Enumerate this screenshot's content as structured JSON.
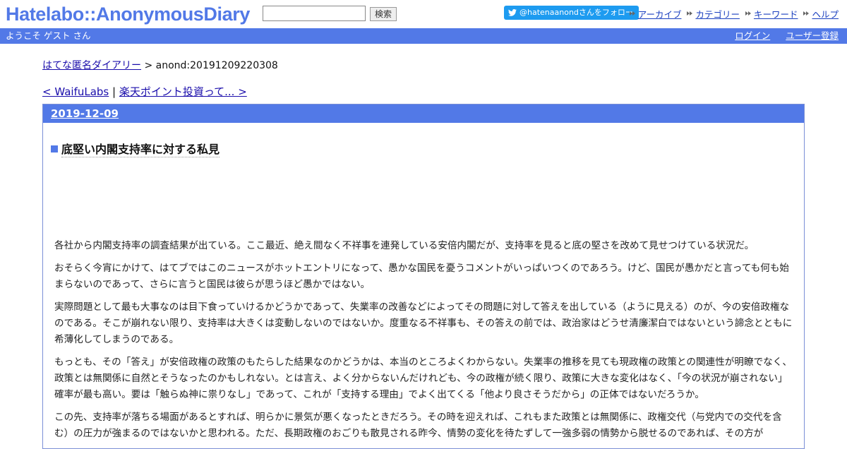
{
  "header": {
    "logo": "Hatelabo::AnonymousDiary",
    "search_placeholder": "",
    "search_button": "検索",
    "twitter_follow": "@hatenaanondさんをフォロー",
    "links": [
      "アーカイブ",
      "カテゴリー",
      "キーワード",
      "ヘルプ"
    ]
  },
  "userbar": {
    "welcome": "ようこそ ゲスト さん",
    "login": "ログイン",
    "register": "ユーザー登録"
  },
  "breadcrumb": {
    "home": "はてな匿名ダイアリー",
    "separator": ">",
    "current": "anond:20191209220308"
  },
  "pager": {
    "prev": "< WaifuLabs",
    "separator": "|",
    "next": "楽天ポイント投資って... >"
  },
  "entry": {
    "date": "2019-12-09",
    "title": "底堅い内閣支持率に対する私見",
    "paragraphs": [
      "各社から内閣支持率の調査結果が出ている。ここ最近、絶え間なく不祥事を連発している安倍内閣だが、支持率を見ると底の堅さを改めて見せつけている状況だ。",
      "おそらく今宵にかけて、はてブではこのニュースがホットエントリになって、愚かな国民を憂うコメントがいっぱいつくのであろう。けど、国民が愚かだと言っても何も始まらないのであって、さらに言うと国民は彼らが思うほど愚かではない。",
      "実際問題として最も大事なのは目下食っていけるかどうかであって、失業率の改善などによってその問題に対して答えを出している（ように見える）のが、今の安倍政権なのである。そこが崩れない限り、支持率は大きくは変動しないのではないか。度重なる不祥事も、その答えの前では、政治家はどうせ清廉潔白ではないという諦念とともに希薄化してしまうのである。",
      "もっとも、その「答え」が安倍政権の政策のもたらした結果なのかどうかは、本当のところよくわからない。失業率の推移を見ても現政権の政策との関連性が明瞭でなく、政策とは無関係に自然とそうなったのかもしれない。とは言え、よく分からないんだけれども、今の政権が続く限り、政策に大きな変化はなく、「今の状況が崩されない」確率が最も高い。要は「触らぬ神に祟りなし」であって、これが「支持する理由」でよく出てくる「他より良さそうだから」の正体ではないだろうか。",
      "この先、支持率が落ちる場面があるとすれば、明らかに景気が悪くなったときだろう。その時を迎えれば、これもまた政策とは無関係に、政権交代（与党内での交代を含む）の圧力が強まるのではないかと思われる。ただ、長期政権のおごりも散見される昨今、情勢の変化を待たずして一強多弱の情勢から脱せるのであれば、その方が"
    ]
  },
  "colors": {
    "brand": "#5279e7",
    "link": "#1a0dab",
    "twitter": "#1d9bf0"
  }
}
